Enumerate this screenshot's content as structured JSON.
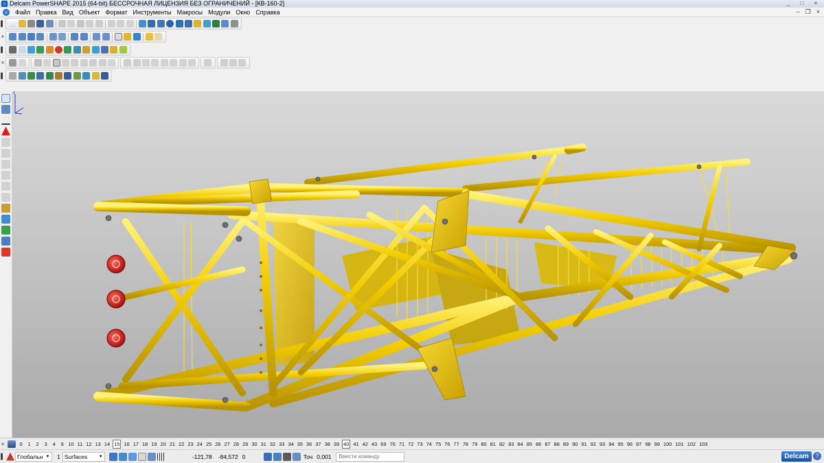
{
  "window": {
    "title": "Delcam PowerSHAPE 2015 (64-bit) БЕССРОЧНАЯ ЛИЦЕНЗИЯ БЕЗ ОГРАНИЧЕНИЙ - [КВ-160-2]",
    "minimize": "_",
    "maximize": "□",
    "close": "×"
  },
  "menu": {
    "items": [
      "Файл",
      "Правка",
      "Вид",
      "Объект",
      "Формат",
      "Инструменты",
      "Макросы",
      "Модули",
      "Окно",
      "Справка"
    ],
    "doc_minimize": "–",
    "doc_restore": "❐",
    "doc_close": "×"
  },
  "toolbars": {
    "grip_close": "×",
    "grip_pin": "▌"
  },
  "layers": {
    "numbers": [
      "0",
      "1",
      "2",
      "3",
      "4",
      "9",
      "10",
      "11",
      "12",
      "13",
      "14",
      "15",
      "16",
      "17",
      "18",
      "19",
      "20",
      "21",
      "22",
      "23",
      "24",
      "25",
      "26",
      "27",
      "28",
      "29",
      "30",
      "31",
      "32",
      "33",
      "34",
      "35",
      "36",
      "37",
      "38",
      "39",
      "40",
      "41",
      "42",
      "43",
      "69",
      "70",
      "71",
      "72",
      "73",
      "74",
      "75",
      "76",
      "77",
      "78",
      "79",
      "80",
      "81",
      "82",
      "83",
      "84",
      "85",
      "86",
      "87",
      "88",
      "89",
      "90",
      "91",
      "92",
      "93",
      "94",
      "95",
      "96",
      "97",
      "98",
      "99",
      "100",
      "101",
      "102",
      "103"
    ],
    "boxed": [
      "15",
      "40"
    ]
  },
  "status": {
    "workplane": "Глобальн",
    "level_number": "1",
    "level_name": "Surfaces",
    "coord_x": "-121,78",
    "coord_y": "-84,572",
    "coord_z": "0",
    "tolerance_label": "Точ",
    "tolerance_value": "0,001",
    "command_placeholder": "Ввести команду",
    "logo": "Delcam",
    "help": "?"
  },
  "colors": {
    "model_yellow": "#f2cc00",
    "model_shadow": "#b89400",
    "handwheel_red": "#d92020",
    "viewport_top": "#d9d9d9",
    "viewport_bottom": "#a9a9a9"
  }
}
